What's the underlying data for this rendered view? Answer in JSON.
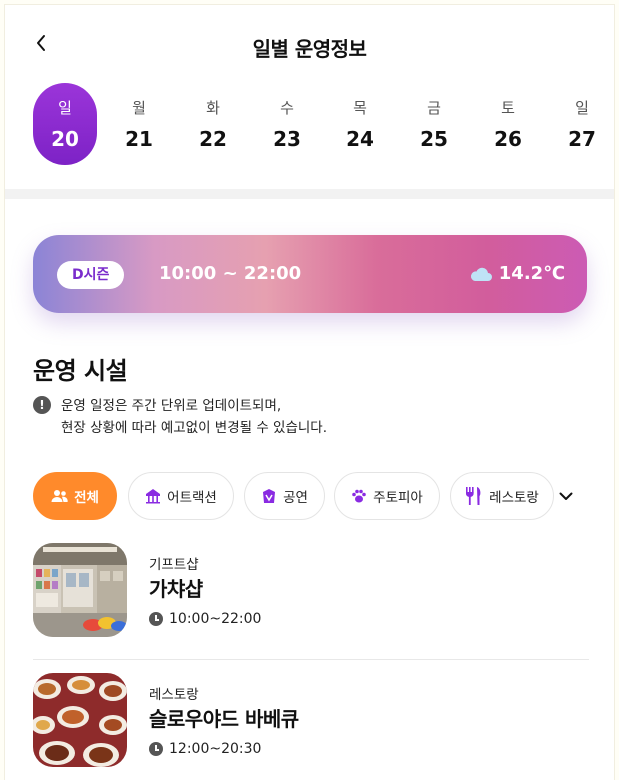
{
  "header": {
    "title": "일별 운영정보"
  },
  "days": [
    {
      "dow": "일",
      "num": "20",
      "active": true
    },
    {
      "dow": "월",
      "num": "21"
    },
    {
      "dow": "화",
      "num": "22"
    },
    {
      "dow": "수",
      "num": "23"
    },
    {
      "dow": "목",
      "num": "24"
    },
    {
      "dow": "금",
      "num": "25"
    },
    {
      "dow": "토",
      "num": "26"
    },
    {
      "dow": "일",
      "num": "27"
    }
  ],
  "season": {
    "badge": "D시즌",
    "hours": "10:00 ~ 22:00",
    "weather_icon": "cloud-icon",
    "temperature": "14.2℃"
  },
  "facilities": {
    "title": "운영 시설",
    "notice_line1": "운영 일정은 주간 단위로 업데이트되며,",
    "notice_line2": "현장 상황에 따라 예고없이 변경될 수 있습니다."
  },
  "filters": [
    {
      "label": "전체",
      "icon": "people-icon",
      "active": true
    },
    {
      "label": "어트랙션",
      "icon": "carousel-icon"
    },
    {
      "label": "공연",
      "icon": "performance-icon"
    },
    {
      "label": "주토피아",
      "icon": "paw-icon"
    },
    {
      "label": "레스토랑",
      "icon": "fork-knife-icon"
    }
  ],
  "items": [
    {
      "category": "기프트샵",
      "name": "가챠샵",
      "hours": "10:00~22:00"
    },
    {
      "category": "레스토랑",
      "name": "슬로우야드 바베큐",
      "hours": "12:00~20:30"
    }
  ],
  "colors": {
    "accent_purple": "#8a2be2",
    "chip_active": "#ff8a2b"
  }
}
